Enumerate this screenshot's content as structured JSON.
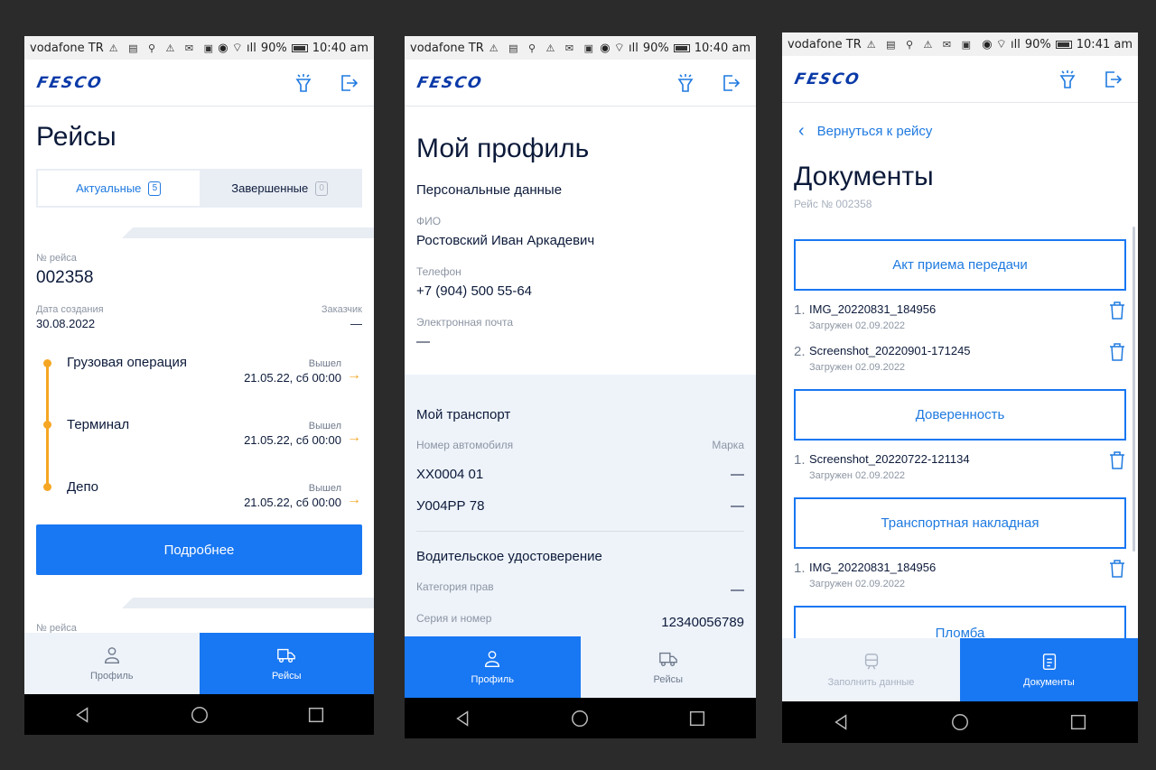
{
  "status_bars": [
    {
      "carrier": "vodafone TR",
      "battery": "90%",
      "time": "10:40 am"
    },
    {
      "carrier": "vodafone TR",
      "battery": "90%",
      "time": "10:40 am"
    },
    {
      "carrier": "vodafone TR",
      "battery": "90%",
      "time": "10:41 am"
    }
  ],
  "logo": "FESCO",
  "trips": {
    "title": "Рейсы",
    "tabs": [
      {
        "label": "Актуальные",
        "count": "5"
      },
      {
        "label": "Завершенные",
        "count": "0"
      }
    ],
    "trip": {
      "number_label": "№ рейса",
      "number": "002358",
      "created_label": "Дата создания",
      "created": "30.08.2022",
      "customer_label": "Заказчик",
      "customer": "—",
      "stops": [
        {
          "name": "Грузовая операция",
          "status": "Вышел",
          "date": "21.05.22, сб 00:00"
        },
        {
          "name": "Терминал",
          "status": "Вышел",
          "date": "21.05.22, сб 00:00"
        },
        {
          "name": "Депо",
          "status": "Вышел",
          "date": "21.05.22, сб 00:00"
        }
      ],
      "details_button": "Подробнее"
    },
    "next_number_label": "№ рейса"
  },
  "profile": {
    "title": "Мой профиль",
    "personal_title": "Персональные данные",
    "fio_label": "ФИО",
    "fio": "Ростовский Иван Аркадевич",
    "phone_label": "Телефон",
    "phone": "+7 (904) 500 55-64",
    "email_label": "Электронная почта",
    "email": "—",
    "transport_title": "Мой транспорт",
    "plate_label": "Номер автомобиля",
    "brand_label": "Марка",
    "vehicles": [
      {
        "plate": "ХХ0004 01",
        "brand": "—"
      },
      {
        "plate": "У004РР 78",
        "brand": "—"
      }
    ],
    "license_title": "Водительское удостоверение",
    "category_label": "Категория прав",
    "category": "—",
    "series_label": "Серия и номер",
    "series": "12340056789"
  },
  "documents": {
    "back_label": "Вернуться к рейсу",
    "title": "Документы",
    "subtitle": "Рейс № 002358",
    "groups": [
      {
        "label": "Акт приема передачи",
        "files": [
          {
            "num": "1.",
            "name": "IMG_20220831_184956",
            "date": "Загружен 02.09.2022"
          },
          {
            "num": "2.",
            "name": "Screenshot_20220901-171245",
            "date": "Загружен 02.09.2022"
          }
        ]
      },
      {
        "label": "Доверенность",
        "files": [
          {
            "num": "1.",
            "name": "Screenshot_20220722-121134",
            "date": "Загружен 02.09.2022"
          }
        ]
      },
      {
        "label": "Транспортная накладная",
        "files": [
          {
            "num": "1.",
            "name": "IMG_20220831_184956",
            "date": "Загружен 02.09.2022"
          }
        ]
      },
      {
        "label": "Пломба",
        "files": []
      }
    ]
  },
  "bottom_tabs": {
    "profile": "Профиль",
    "trips": "Рейсы",
    "fill_data": "Заполнить данные",
    "documents": "Документы"
  },
  "colors": {
    "accent": "#1877f2",
    "timeline": "#f5a623",
    "text": "#0c1a3a",
    "muted": "#8c95a3"
  }
}
